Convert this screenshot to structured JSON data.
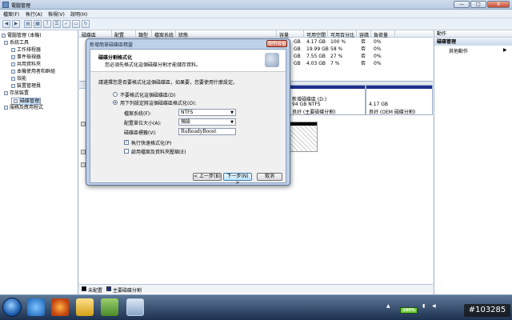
{
  "window": {
    "title": "電腦管理",
    "min": "—",
    "max": "□",
    "close": "X"
  },
  "menu": [
    "檔案(F)",
    "執行(A)",
    "檢視(V)",
    "說明(H)"
  ],
  "tree": {
    "items": [
      "電腦管理 (本機)",
      "系統工具",
      "工作排程器",
      "事件檢視器",
      "共用資料夾",
      "本機使用者和群組",
      "效能",
      "裝置管理員",
      "存放裝置",
      "磁碟管理",
      "服務及應用程式"
    ]
  },
  "grid": {
    "headers": [
      "磁碟區",
      "配置",
      "類型",
      "檔案系統",
      "狀態",
      "容量",
      "可用空間",
      "可用百分比",
      "容錯",
      "負荷量"
    ],
    "rows": [
      {
        "cap": "GB",
        "free": "4.17 GB",
        "pct": "100 %",
        "ft": "否",
        "oh": "0%"
      },
      {
        "cap": "GB",
        "free": "19.99 GB",
        "pct": "58 %",
        "ft": "否",
        "oh": "0%"
      },
      {
        "cap": "GB",
        "free": "7.55 GB",
        "pct": "27 %",
        "ft": "否",
        "oh": "0%"
      },
      {
        "cap": "GB",
        "free": "4.03 GB",
        "pct": "7 %",
        "ft": "否",
        "oh": "0%"
      }
    ]
  },
  "diskmap": {
    "p1": {
      "name": "新增磁碟區 (D:)",
      "size": "94 GB NTFS",
      "status": "良好 (主要磁碟分割)"
    },
    "p2": {
      "size": "4.17 GB",
      "status": "良好 (OEM 磁碟分割)"
    }
  },
  "legend": {
    "unalloc": "未配置",
    "primary": "主要磁碟分割"
  },
  "actions": {
    "header": "動作",
    "section": "磁碟管理",
    "item": "其他動作"
  },
  "dialog": {
    "title": "新增簡單磁碟區精靈",
    "close": "關閉視窗",
    "heading": "磁碟分割格式化",
    "subheading": "您必須先格式化這個磁碟分割才能儲存資料。",
    "prompt": "請選擇您是否要格式化這個磁碟區，如果要，您要使用什麼設定。",
    "opt_noformat": "不要格式化這個磁碟區(D)",
    "opt_format": "用下列設定將這個磁碟區格式化(O):",
    "fs_label": "檔案系統(F):",
    "fs_value": "NTFS",
    "unit_label": "配置單位大小(A):",
    "unit_value": "預設",
    "vol_label": "磁碟區標籤(V):",
    "vol_value": "RuReadyBoost",
    "quick": "執行快速格式化(P)",
    "compress": "啟用檔案及資料夾壓縮(E)",
    "back": "< 上一步(B)",
    "next": "下一步(N) >",
    "cancel": "取消"
  },
  "tray": {
    "battery": "100%"
  },
  "watermark": "#103285"
}
